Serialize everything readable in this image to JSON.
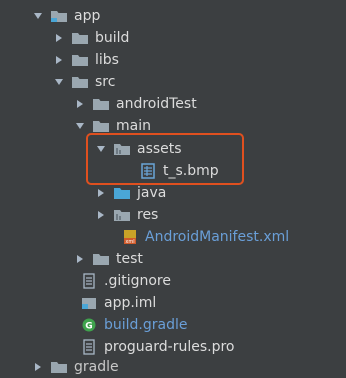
{
  "tree": {
    "items": [
      {
        "label": "app",
        "expanded": true,
        "type": "module-folder"
      },
      {
        "label": "build",
        "expanded": false,
        "type": "folder"
      },
      {
        "label": "libs",
        "expanded": false,
        "type": "folder"
      },
      {
        "label": "src",
        "expanded": true,
        "type": "folder"
      },
      {
        "label": "androidTest",
        "expanded": false,
        "type": "folder"
      },
      {
        "label": "main",
        "expanded": true,
        "type": "folder"
      },
      {
        "label": "assets",
        "expanded": true,
        "type": "assets-folder"
      },
      {
        "label": "t_s.bmp",
        "type": "image-file"
      },
      {
        "label": "java",
        "expanded": false,
        "type": "java-folder"
      },
      {
        "label": "res",
        "expanded": false,
        "type": "res-folder"
      },
      {
        "label": "AndroidManifest.xml",
        "type": "xml-file"
      },
      {
        "label": "test",
        "expanded": false,
        "type": "folder"
      },
      {
        "label": ".gitignore",
        "type": "text-file"
      },
      {
        "label": "app.iml",
        "type": "iml-file"
      },
      {
        "label": "build.gradle",
        "type": "gradle-file"
      },
      {
        "label": "proguard-rules.pro",
        "type": "text-file"
      },
      {
        "label": "gradle",
        "expanded": false,
        "type": "folder"
      }
    ]
  },
  "colors": {
    "background": "#3c3f41",
    "text": "#dcdcdc",
    "link_text": "#6a9fd8",
    "folder": "#9aa7b0",
    "java_folder": "#4aa6d6",
    "highlight_border": "#e0501f"
  }
}
